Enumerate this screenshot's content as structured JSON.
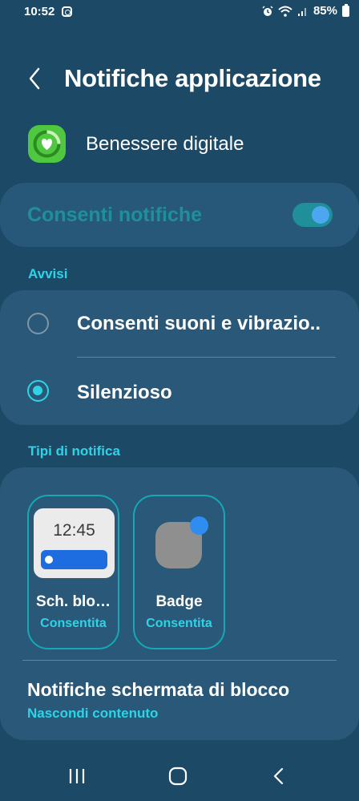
{
  "status_bar": {
    "time": "10:52",
    "battery": "85%",
    "icons": [
      "instagram-icon",
      "alarm-icon",
      "wifi-icon",
      "signal-icon",
      "battery-icon"
    ]
  },
  "header": {
    "title": "Notifiche applicazione",
    "back_icon": "chevron-left-icon"
  },
  "app": {
    "name": "Benessere digitale",
    "icon": "digital-wellbeing-icon",
    "icon_color": "#4fc73e"
  },
  "allow": {
    "label": "Consenti notifiche",
    "enabled": true,
    "accent": "#1f8f9a"
  },
  "alerts": {
    "section_label": "Avvisi",
    "options": [
      {
        "label": "Consenti suoni e vibrazio..",
        "selected": false
      },
      {
        "label": "Silenzioso",
        "selected": true
      }
    ]
  },
  "types": {
    "section_label": "Tipi di notifica",
    "tiles": [
      {
        "title": "Sch. blo…",
        "status": "Consentita",
        "preview_time": "12:45"
      },
      {
        "title": "Badge",
        "status": "Consentita"
      }
    ]
  },
  "lock_notifications": {
    "title": "Notifiche schermata di blocco",
    "value": "Nascondi contenuto"
  },
  "nav": {
    "icons": [
      "recents-icon",
      "home-icon",
      "back-icon"
    ]
  },
  "colors": {
    "background": "#1c4966",
    "card": "#2a5878",
    "accent": "#2fd3e6"
  }
}
